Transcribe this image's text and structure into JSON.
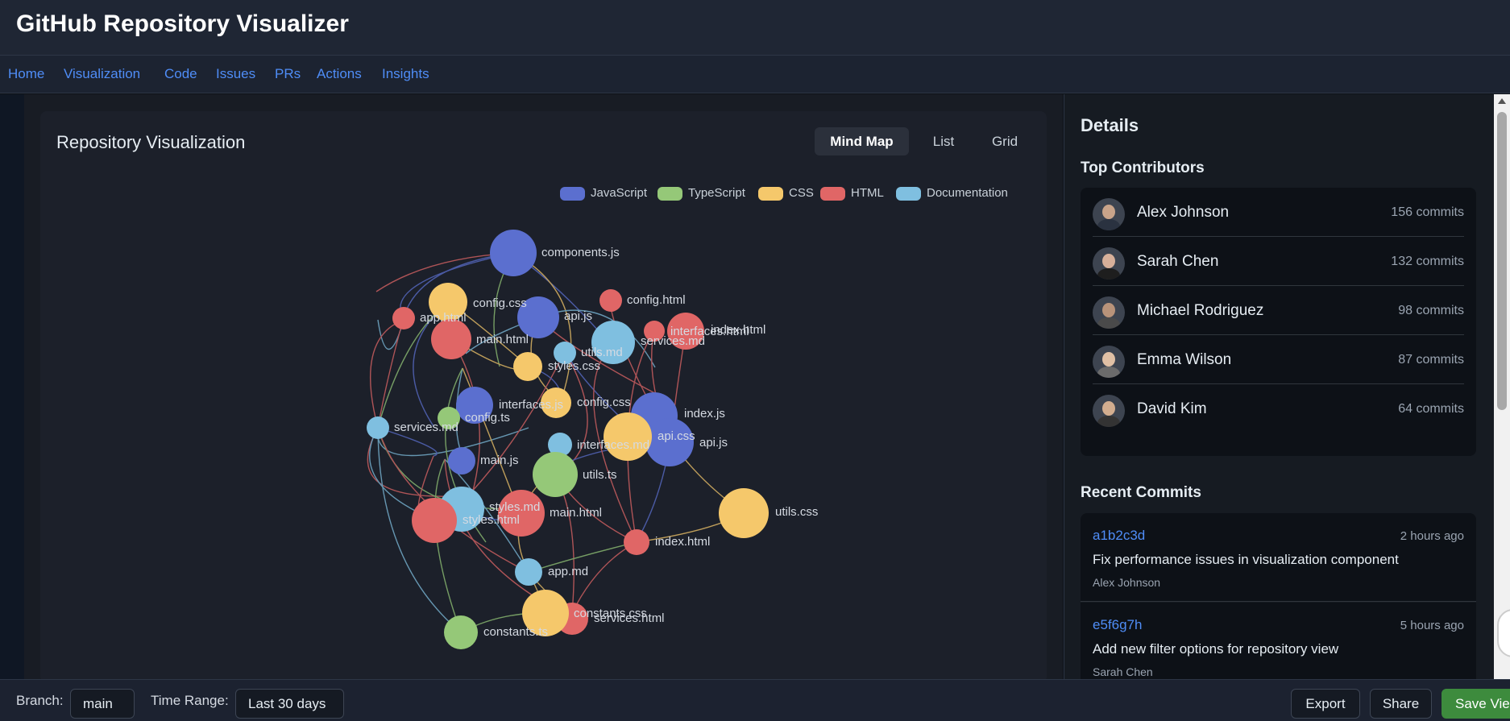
{
  "app": {
    "title": "GitHub Repository Visualizer"
  },
  "nav": {
    "items": [
      "Home",
      "Visualization",
      "Code",
      "Issues",
      "PRs",
      "Actions",
      "Insights"
    ]
  },
  "visualization": {
    "title": "Repository Visualization",
    "views": [
      "Mind Map",
      "List",
      "Grid"
    ],
    "active_view": "Mind Map",
    "legend": [
      {
        "label": "JavaScript",
        "color": "#5b6fcf"
      },
      {
        "label": "TypeScript",
        "color": "#95c878"
      },
      {
        "label": "CSS",
        "color": "#f5c86b"
      },
      {
        "label": "HTML",
        "color": "#e06666"
      },
      {
        "label": "Documentation",
        "color": "#7fbfe0"
      }
    ]
  },
  "details": {
    "title": "Details",
    "contributors_title": "Top Contributors",
    "contributors": [
      {
        "name": "Alex Johnson",
        "commits": "156 commits"
      },
      {
        "name": "Sarah Chen",
        "commits": "132 commits"
      },
      {
        "name": "Michael Rodriguez",
        "commits": "98 commits"
      },
      {
        "name": "Emma Wilson",
        "commits": "87 commits"
      },
      {
        "name": "David Kim",
        "commits": "64 commits"
      }
    ],
    "commits_title": "Recent Commits",
    "commits": [
      {
        "hash": "a1b2c3d",
        "time": "2 hours ago",
        "message": "Fix performance issues in visualization component",
        "author": "Alex Johnson"
      },
      {
        "hash": "e5f6g7h",
        "time": "5 hours ago",
        "message": "Add new filter options for repository view",
        "author": "Sarah Chen"
      }
    ]
  },
  "footer": {
    "branch_label": "Branch:",
    "branch_value": "main",
    "range_label": "Time Range:",
    "range_value": "Last 30 days",
    "export_label": "Export",
    "share_label": "Share",
    "save_label": "Save View"
  }
}
